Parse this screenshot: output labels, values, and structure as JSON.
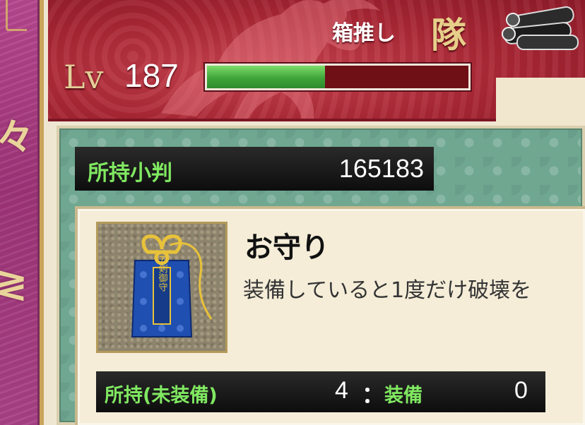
{
  "header": {
    "team_label": "箱推し",
    "team_kanji": "隊",
    "level_label": "Lv",
    "level_value": "187",
    "exp_progress": 0.45
  },
  "koban": {
    "label": "所持小判",
    "value": "165183"
  },
  "item": {
    "name": "お守り",
    "description": "装備していると1度だけ破壊を",
    "icon": "omamori-charm-icon",
    "icon_text": "刀剣御守"
  },
  "inventory": {
    "label": "所持(未装備)",
    "unequipped_count": "4",
    "separator": "：",
    "equipped_label": "装備",
    "equipped_count": "0"
  },
  "colors": {
    "banner_red": "#a82634",
    "exp_green": "#3fa53a",
    "board_teal": "#6fa791",
    "label_green": "#80e861",
    "side_magenta": "#a84185"
  }
}
